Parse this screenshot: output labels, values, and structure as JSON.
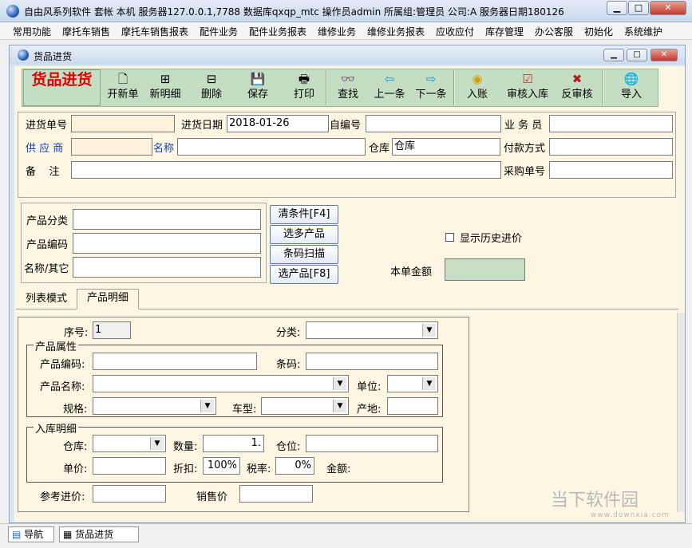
{
  "app": {
    "title": "自由风系列软件  套帐 本机  服务器127.0.0.1,7788  数据库qxqp_mtc  操作员admin  所属组:管理员  公司:A  服务器日期180126"
  },
  "menu": [
    "常用功能",
    "摩托车销售",
    "摩托车销售报表",
    "配件业务",
    "配件业务报表",
    "维修业务",
    "维修业务报表",
    "应收应付",
    "库存管理",
    "办公客服",
    "初始化",
    "系统维护"
  ],
  "child": {
    "title": "货品进货"
  },
  "toolbar": {
    "module_title": "货品进货",
    "buttons": [
      {
        "label": "开新单",
        "icon": "new-doc-icon",
        "glyph": "🗋"
      },
      {
        "label": "新明细",
        "icon": "add-row-icon",
        "glyph": "⊞"
      },
      {
        "label": "删除",
        "icon": "delete-row-icon",
        "glyph": "⊟"
      },
      {
        "label": "保存",
        "icon": "floppy-disk-icon",
        "glyph": "💾"
      },
      {
        "label": "打印",
        "icon": "printer-icon",
        "glyph": "🖶"
      },
      {
        "label": "查找",
        "icon": "binoculars-icon",
        "glyph": "👓"
      },
      {
        "label": "上一条",
        "icon": "arrow-left-icon",
        "glyph": "⇦"
      },
      {
        "label": "下一条",
        "icon": "arrow-right-icon",
        "glyph": "⇨"
      },
      {
        "label": "入账",
        "icon": "ledger-icon",
        "glyph": "◉"
      },
      {
        "label": "审核入库",
        "icon": "clipboard-check-icon",
        "glyph": "☑"
      },
      {
        "label": "反审核",
        "icon": "unapprove-icon",
        "glyph": "✖"
      },
      {
        "label": "导入",
        "icon": "globe-icon",
        "glyph": "🌐"
      }
    ]
  },
  "header": {
    "order_no_label": "进货单号",
    "order_no": "",
    "date_label": "进货日期",
    "date": "2018-01-26",
    "self_no_label": "自编号",
    "self_no": "",
    "staff_label": "业 务 员",
    "staff": "",
    "supplier_label": "供 应 商",
    "supplier": "",
    "name_label": "名称",
    "name": "",
    "warehouse_label": "仓库",
    "warehouse": "仓库",
    "payment_label": "付款方式",
    "payment": "",
    "remark_label": "备    注",
    "remark": "",
    "purchase_no_label": "采购单号",
    "purchase_no": ""
  },
  "filter": {
    "category_label": "产品分类",
    "code_label": "产品编码",
    "name_label": "名称/其它",
    "clear_btn": "清条件[F4]",
    "multi_btn": "选多产品",
    "barcode_btn": "条码扫描",
    "select_btn": "选产品[F8]",
    "history_label": "显示历史进价",
    "total_label": "本单金额",
    "total": ""
  },
  "tabs": [
    "列表模式",
    "产品明细"
  ],
  "detail": {
    "seq_label": "序号:",
    "seq": "1",
    "category_label": "分类:",
    "attr_group": "产品属性",
    "code_label": "产品编码:",
    "barcode_label": "条码:",
    "pname_label": "产品名称:",
    "unit_label": "单位:",
    "spec_label": "规格:",
    "model_label": "车型:",
    "origin_label": "产地:",
    "stock_group": "入库明细",
    "wh_label": "仓库:",
    "qty_label": "数量:",
    "qty": "1.",
    "loc_label": "仓位:",
    "price_label": "单价:",
    "discount_label": "折扣:",
    "discount": "100%",
    "tax_label": "税率:",
    "tax": "0%",
    "amount_label": "金额:",
    "ref_price_label": "参考进价:",
    "sale_price_label": "销售价"
  },
  "status": {
    "nav": "导航",
    "window": "货品进货"
  },
  "watermark": {
    "main": "当下软件园",
    "sub": "www.downxia.com"
  }
}
